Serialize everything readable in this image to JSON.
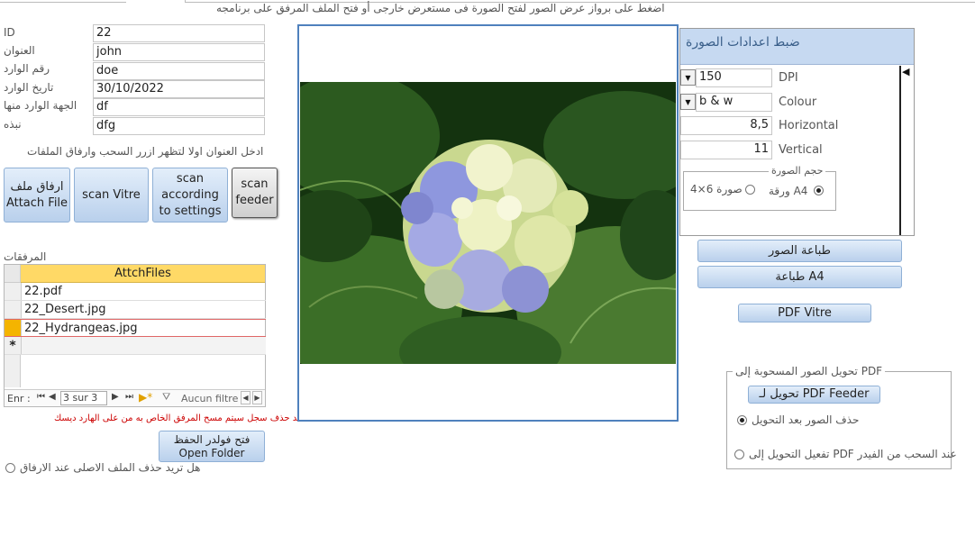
{
  "header": {
    "hint": "اضغط على برواز عرض الصور لفتح الصورة فى مستعرض خارجى أو فتح الملف المرفق على برنامجه"
  },
  "form": {
    "fields": [
      {
        "label": "ID",
        "value": "22"
      },
      {
        "label": "العنوان",
        "value": "john"
      },
      {
        "label": "رقم الوارد",
        "value": "doe"
      },
      {
        "label": "تاريخ الوارد",
        "value": "30/10/2022"
      },
      {
        "label": "الجهة  الوارد منها",
        "value": "df"
      },
      {
        "label": "نبذه",
        "value": "dfg"
      }
    ],
    "instruction": "ادخل العنوان اولا لتظهر ازرر السحب وارفاق الملفات"
  },
  "actions": {
    "attach_line1": "ارفاق ملف",
    "attach_line2": "Attach File",
    "scan_vitre": "scan Vitre",
    "scan_settings": "scan according to settings",
    "scan_feeder": "scan feeder"
  },
  "attachments": {
    "label": "المرفقات",
    "column": "AttchFiles",
    "rows": [
      "22.pdf",
      "22_Desert.jpg",
      "22_Hydrangeas.jpg"
    ],
    "new_row_marker": "*"
  },
  "navigator": {
    "record_label": "Enr :",
    "position": "3 sur 3",
    "filter_label": "Aucun filtre"
  },
  "warning": "عند حذف سجل سيتم مسح المرفق الخاص به من على الهارد ديسك",
  "open_folder": {
    "line1": "فتح فولدر الحفظ",
    "line2": "Open Folder"
  },
  "delete_original_label": "هل تريد حذف الملف الاصلى عند الارفاق",
  "settings": {
    "title": "ضبط اعدادات الصورة",
    "dpi": {
      "label": "DPI",
      "value": "150"
    },
    "colour": {
      "label": "Colour",
      "value": "b & w"
    },
    "horizontal": {
      "label": "Horizontal",
      "value": "8,5"
    },
    "vertical": {
      "label": "Vertical",
      "value": "11"
    },
    "size_group": "حجم الصورة",
    "size_a4": "ورقة A4",
    "size_6x4": "صورة 6×4",
    "size_selected": "A4"
  },
  "print": {
    "images": "طباعة الصور",
    "a4": "طباعة A4",
    "pdf_vitre": "PDF Vitre"
  },
  "convert": {
    "group": "تحويل الصور المسحوبة إلى PDF",
    "feeder_button": "تحويل لـ PDF Feeder",
    "delete_after": "حذف الصور بعد التحويل",
    "enable_on_feeder": "تفعيل التحويل إلى PDF عند السحب من الفيدر"
  },
  "colors": {
    "grid_header": "#ffd966",
    "selected_row": "#f4b400",
    "settings_header": "#c6d9f1",
    "frame_border": "#4f81bd",
    "warning_text": "#cc0000"
  },
  "icons": {
    "record_first": "first-record-icon",
    "record_prev": "prev-record-icon",
    "record_next": "next-record-icon",
    "record_last": "last-record-icon",
    "record_new": "new-record-icon",
    "filter": "filter-icon"
  }
}
